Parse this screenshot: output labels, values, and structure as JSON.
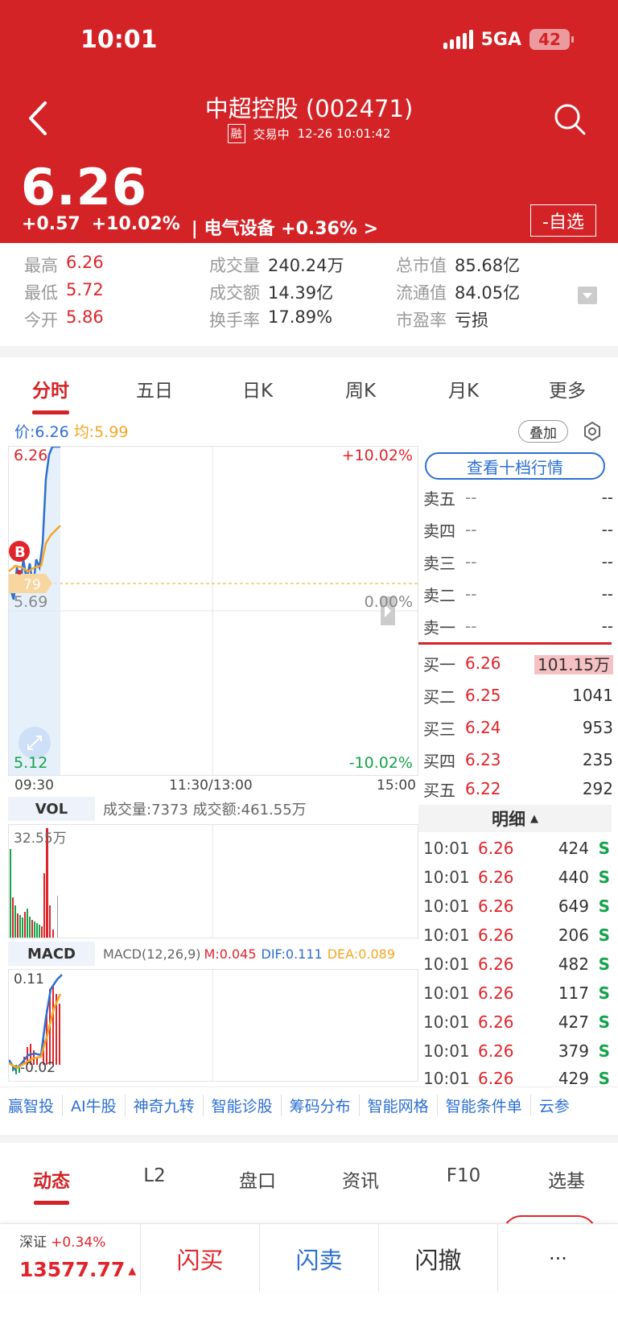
{
  "status": {
    "time": "10:01",
    "network": "5GA",
    "battery": "42"
  },
  "header": {
    "title": "中超控股 (002471)",
    "rong": "融",
    "trading_status": "交易中",
    "datetime": "12-26 10:01:42",
    "price": "6.26",
    "change": "+0.57",
    "change_pct": "+10.02%",
    "sector": "| 电气设备 +0.36% >",
    "watch_label": "-自选"
  },
  "stats": {
    "high_label": "最高",
    "high": "6.26",
    "low_label": "最低",
    "low": "5.72",
    "open_label": "今开",
    "open": "5.86",
    "volume_label": "成交量",
    "volume": "240.24万",
    "amount_label": "成交额",
    "amount": "14.39亿",
    "turnover_label": "换手率",
    "turnover": "17.89%",
    "mcap_label": "总市值",
    "mcap": "85.68亿",
    "float_label": "流通值",
    "float": "84.05亿",
    "pe_label": "市盈率",
    "pe": "亏损"
  },
  "chart_tabs": [
    "分时",
    "五日",
    "日K",
    "周K",
    "月K",
    "更多"
  ],
  "intraday": {
    "price_label": "价:6.26",
    "avg_label": "均:5.99",
    "overlay_label": "叠加",
    "y_top": "6.26",
    "y_mid": "5.69",
    "y_bot": "5.12",
    "pct_top": "+10.02%",
    "pct_mid": "0.00%",
    "pct_bot": "-10.02%",
    "avg_marker": "79",
    "buy_marker": "B",
    "x_start": "09:30",
    "x_mid": "11:30/13:00",
    "x_end": "15:00"
  },
  "vol": {
    "tag": "VOL",
    "summary": "成交量:7373 成交额:461.55万",
    "max_label": "32.55万"
  },
  "macd": {
    "tag": "MACD",
    "params": "MACD(12,26,9)",
    "m": "M:0.045",
    "dif": "DIF:0.111",
    "dea": "DEA:0.089",
    "top": "0.11",
    "bottom": "-0.02"
  },
  "orderbook": {
    "ten_levels_label": "查看十档行情",
    "asks": [
      {
        "name": "卖五",
        "price": "--",
        "vol": "--"
      },
      {
        "name": "卖四",
        "price": "--",
        "vol": "--"
      },
      {
        "name": "卖三",
        "price": "--",
        "vol": "--"
      },
      {
        "name": "卖二",
        "price": "--",
        "vol": "--"
      },
      {
        "name": "卖一",
        "price": "--",
        "vol": "--"
      }
    ],
    "bids": [
      {
        "name": "买一",
        "price": "6.26",
        "vol": "101.15万"
      },
      {
        "name": "买二",
        "price": "6.25",
        "vol": "1041"
      },
      {
        "name": "买三",
        "price": "6.24",
        "vol": "953"
      },
      {
        "name": "买四",
        "price": "6.23",
        "vol": "235"
      },
      {
        "name": "买五",
        "price": "6.22",
        "vol": "292"
      }
    ]
  },
  "ticks": {
    "header": "明细",
    "rows": [
      {
        "t": "10:01",
        "p": "6.26",
        "v": "424",
        "s": "S"
      },
      {
        "t": "10:01",
        "p": "6.26",
        "v": "440",
        "s": "S"
      },
      {
        "t": "10:01",
        "p": "6.26",
        "v": "649",
        "s": "S"
      },
      {
        "t": "10:01",
        "p": "6.26",
        "v": "206",
        "s": "S"
      },
      {
        "t": "10:01",
        "p": "6.26",
        "v": "482",
        "s": "S"
      },
      {
        "t": "10:01",
        "p": "6.26",
        "v": "117",
        "s": "S"
      },
      {
        "t": "10:01",
        "p": "6.26",
        "v": "427",
        "s": "S"
      },
      {
        "t": "10:01",
        "p": "6.26",
        "v": "379",
        "s": "S"
      },
      {
        "t": "10:01",
        "p": "6.26",
        "v": "429",
        "s": "S"
      }
    ]
  },
  "tools": [
    "赢智投",
    "AI牛股",
    "神奇九转",
    "智能诊股",
    "筹码分布",
    "智能网格",
    "智能条件单",
    "云参"
  ],
  "bottom_tabs": [
    "动态",
    "L2",
    "盘口",
    "资讯",
    "F10",
    "选基"
  ],
  "action_bar": {
    "index_name": "深证",
    "index_change": "+0.34%",
    "index_value": "13577.77",
    "flash_buy": "闪买",
    "flash_sell": "闪卖",
    "flash_cancel": "闪撤",
    "more": "···"
  },
  "colors": {
    "header_red": "#d32326",
    "up": "#e0242a",
    "down": "#14a34a",
    "link": "#2d6fd1",
    "avg": "#f5a623"
  }
}
